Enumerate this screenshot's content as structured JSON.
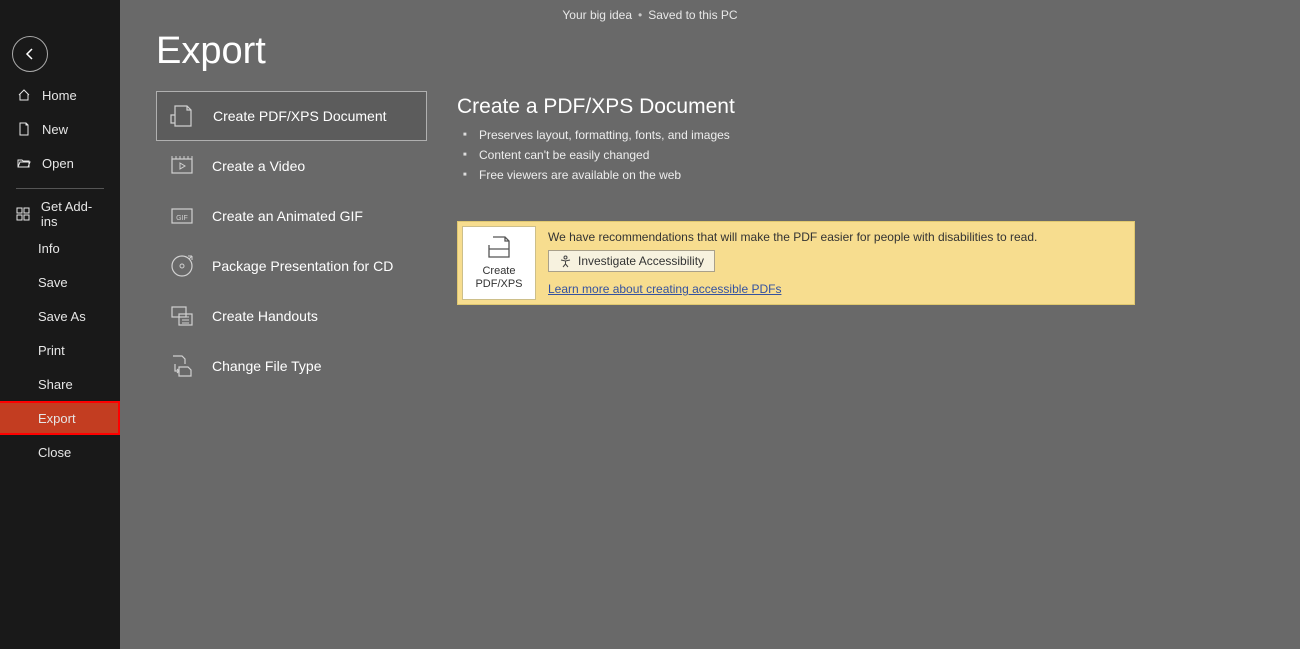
{
  "title_bar": {
    "doc_name": "Your big idea",
    "save_status": "Saved to this PC"
  },
  "sidebar": {
    "items": [
      {
        "label": "Home"
      },
      {
        "label": "New"
      },
      {
        "label": "Open"
      },
      {
        "label": "Get Add-ins"
      },
      {
        "label": "Info"
      },
      {
        "label": "Save"
      },
      {
        "label": "Save As"
      },
      {
        "label": "Print"
      },
      {
        "label": "Share"
      },
      {
        "label": "Export"
      },
      {
        "label": "Close"
      }
    ]
  },
  "page_title": "Export",
  "export_options": [
    {
      "label": "Create PDF/XPS Document"
    },
    {
      "label": "Create a Video"
    },
    {
      "label": "Create an Animated GIF"
    },
    {
      "label": "Package Presentation for CD"
    },
    {
      "label": "Create Handouts"
    },
    {
      "label": "Change File Type"
    }
  ],
  "detail": {
    "title": "Create a PDF/XPS Document",
    "bullets": [
      "Preserves layout, formatting, fonts, and images",
      "Content can't be easily changed",
      "Free viewers are available on the web"
    ]
  },
  "recommendation": {
    "create_btn_line1": "Create",
    "create_btn_line2": "PDF/XPS",
    "text": "We have recommendations that will make the PDF easier for people with disabilities to read.",
    "investigate_btn": "Investigate Accessibility",
    "learn_more": "Learn more about creating accessible PDFs"
  }
}
